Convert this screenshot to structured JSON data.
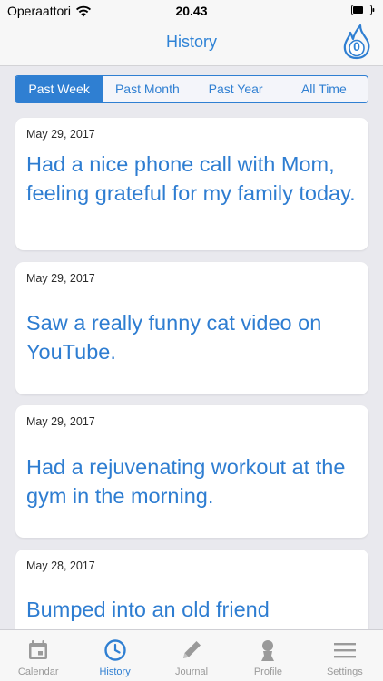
{
  "status_bar": {
    "carrier": "Operaattori",
    "time": "20.43"
  },
  "nav": {
    "title": "History",
    "streak_count": "0"
  },
  "segments": [
    {
      "label": "Past Week",
      "active": true
    },
    {
      "label": "Past Month",
      "active": false
    },
    {
      "label": "Past Year",
      "active": false
    },
    {
      "label": "All Time",
      "active": false
    }
  ],
  "entries": [
    {
      "date": "May 29, 2017",
      "text": "Had a nice phone call with Mom, feeling grateful for my family today."
    },
    {
      "date": "May 29, 2017",
      "text": "Saw a really funny cat video on YouTube."
    },
    {
      "date": "May 29, 2017",
      "text": "Had a rejuvenating workout at the gym in the morning."
    },
    {
      "date": "May 28, 2017",
      "text": "Bumped into an old friend"
    }
  ],
  "tabs": [
    {
      "label": "Calendar",
      "icon": "calendar-icon",
      "active": false
    },
    {
      "label": "History",
      "icon": "clock-icon",
      "active": true
    },
    {
      "label": "Journal",
      "icon": "pencil-icon",
      "active": false
    },
    {
      "label": "Profile",
      "icon": "person-icon",
      "active": false
    },
    {
      "label": "Settings",
      "icon": "menu-icon",
      "active": false
    }
  ],
  "colors": {
    "accent": "#2f7fd2",
    "entry_text": "#2e7dd1",
    "background": "#e9e9ee"
  }
}
